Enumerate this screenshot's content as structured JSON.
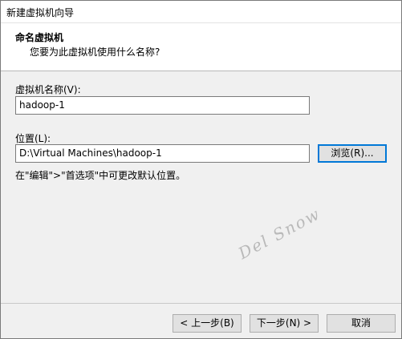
{
  "window": {
    "title": "新建虚拟机向导"
  },
  "header": {
    "title": "命名虚拟机",
    "subtitle": "您要为此虚拟机使用什么名称?"
  },
  "form": {
    "name_label": "虚拟机名称(V):",
    "name_value": "hadoop-1",
    "location_label": "位置(L):",
    "location_value": "D:\\Virtual Machines\\hadoop-1",
    "browse_label": "浏览(R)...",
    "hint": "在\"编辑\">\"首选项\"中可更改默认位置。"
  },
  "watermark": "Del Snow",
  "footer": {
    "back_label": "< 上一步(B)",
    "next_label": "下一步(N) >",
    "cancel_label": "取消"
  }
}
